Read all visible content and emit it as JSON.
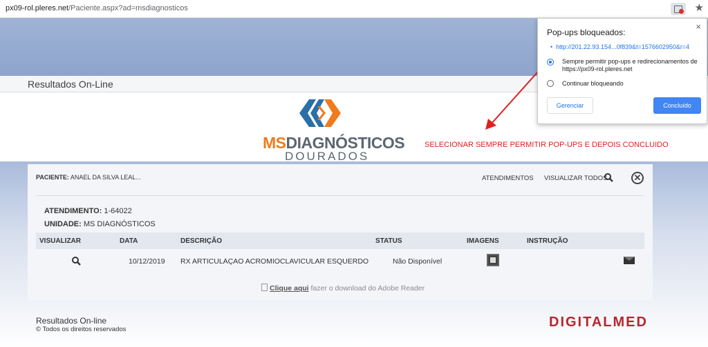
{
  "browser": {
    "url_host": "px09-rol.pleres.net",
    "url_path": "/Paciente.aspx?ad=msdiagnosticos",
    "popup_icon": "popup-blocked-icon",
    "star_icon": "★"
  },
  "header": {
    "title": "Resultados On-Line"
  },
  "logo": {
    "ms": "MS",
    "name": "DIAGNÓSTICOS",
    "city": "DOURADOS"
  },
  "annotation": "SELECIONAR SEMPRE PERMITIR POP-UPS E DEPOIS CONCLUIDO",
  "patient": {
    "label": "PACIENTE:",
    "name": "ANAEL DA SILVA LEAL...",
    "atendimentos_link": "ATENDIMENTOS",
    "visualizar_todos": "VISUALIZAR TODOS",
    "close_glyph": "✕"
  },
  "attendance": {
    "label": "ATENDIMENTO:",
    "value": "1-64022",
    "unit_label": "UNIDADE:",
    "unit_value": "MS DIAGNÓSTICOS"
  },
  "table": {
    "headers": [
      "VISUALIZAR",
      "DATA",
      "DESCRIÇÃO",
      "STATUS",
      "IMAGENS",
      "INSTRUÇÃO"
    ],
    "rows": [
      {
        "date": "10/12/2019",
        "description": "RX ARTICULAÇAO ACROMIOCLAVICULAR ESQUERDO",
        "status": "Não Disponível"
      }
    ]
  },
  "download": {
    "link": "Clique aqui",
    "text": " fazer o download do Adobe Reader"
  },
  "footer": {
    "title": "Resultados On-line",
    "copyright": "© Todos os direitos reservados",
    "brand": "DIGITALMED"
  },
  "popup": {
    "title": "Pop-ups bloqueados:",
    "close": "×",
    "link": "http://201.22.93.154...0f839&t=1576602950&r=4",
    "option_allow": "Sempre permitir pop-ups e redirecionamentos de https://px09-rol.pleres.net",
    "option_block": "Continuar bloqueando",
    "manage_label": "Gerenciar",
    "done_label": "Concluído"
  },
  "colors": {
    "accent": "#1a73e8",
    "annotation": "#e02020",
    "brand_orange": "#f07b1d",
    "brand_red": "#b7262d"
  }
}
